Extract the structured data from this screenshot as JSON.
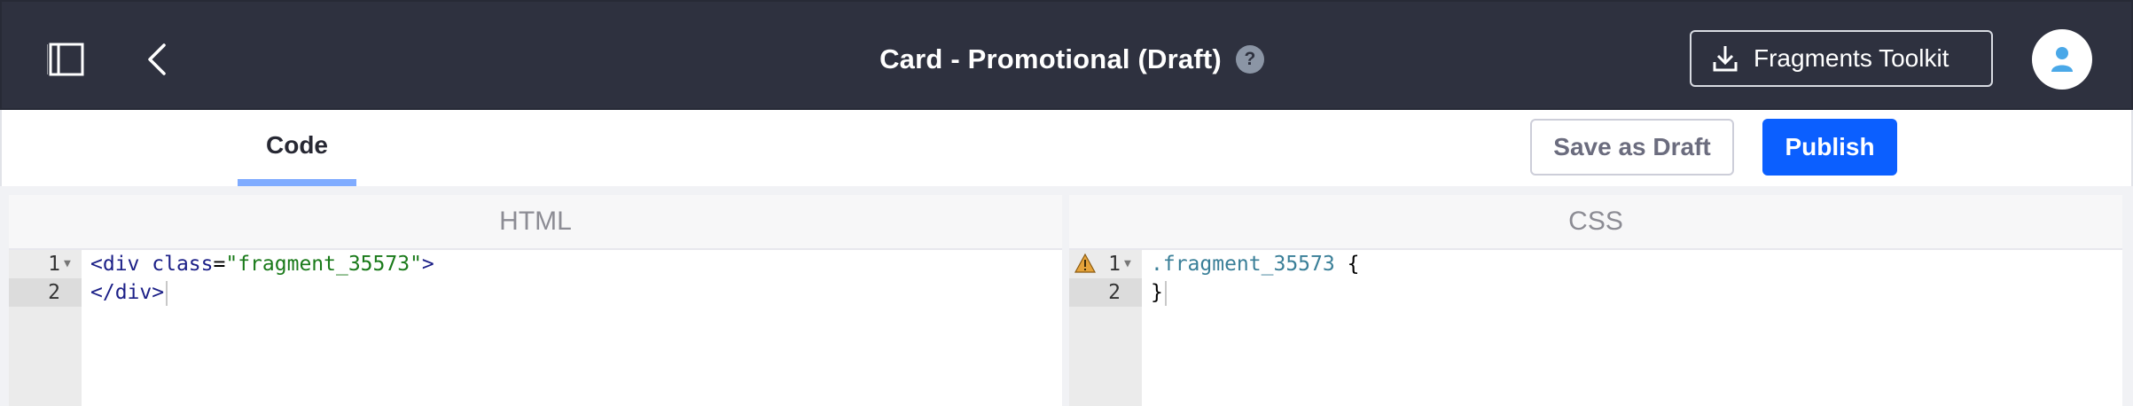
{
  "header": {
    "title": "Card - Promotional (Draft)",
    "help_glyph": "?",
    "toolkit_label": "Fragments Toolkit"
  },
  "subbar": {
    "tab_code": "Code",
    "save_draft_label": "Save as Draft",
    "publish_label": "Publish"
  },
  "editors": {
    "html": {
      "title": "HTML",
      "lines": [
        {
          "num": "1",
          "parts": {
            "open": "<div ",
            "attr": "class",
            "eq": "=",
            "str": "\"fragment_35573\"",
            "close": ">"
          }
        },
        {
          "num": "2",
          "text": "</div>"
        }
      ]
    },
    "css": {
      "title": "CSS",
      "lines": [
        {
          "num": "1",
          "selector": ".fragment_35573",
          "brace": "{"
        },
        {
          "num": "2",
          "text": "}"
        }
      ]
    }
  },
  "colors": {
    "topbar": "#2e313f",
    "primary": "#0b5fff",
    "tab_underline": "#80acff"
  },
  "icons": [
    "sidebar-toggle-icon",
    "chevron-left-icon",
    "help-icon",
    "download-icon",
    "user-icon",
    "warning-icon",
    "fold-arrow-icon"
  ]
}
